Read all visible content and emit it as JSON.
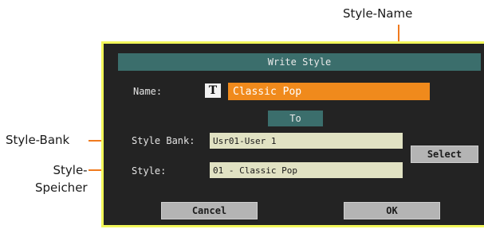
{
  "callouts": {
    "style_name": "Style-Name",
    "style_bank": "Style-Bank",
    "style_speicher_line1": "Style-",
    "style_speicher_line2": "Speicher"
  },
  "dialog": {
    "title": "Write Style",
    "name_label": "Name:",
    "name_value": "Classic Pop",
    "text_edit_icon": "T",
    "to_label": "To",
    "bank_label": "Style Bank:",
    "bank_value": "Usr01-User 1",
    "style_label": "Style:",
    "style_value": "01 - Classic Pop",
    "select_label": "Select",
    "cancel_label": "Cancel",
    "ok_label": "OK"
  },
  "colors": {
    "frame": "#f3f75a",
    "background": "#232323",
    "title_bar": "#3b6e6c",
    "name_field": "#f08a1c",
    "callout_line": "#f07a1e"
  }
}
